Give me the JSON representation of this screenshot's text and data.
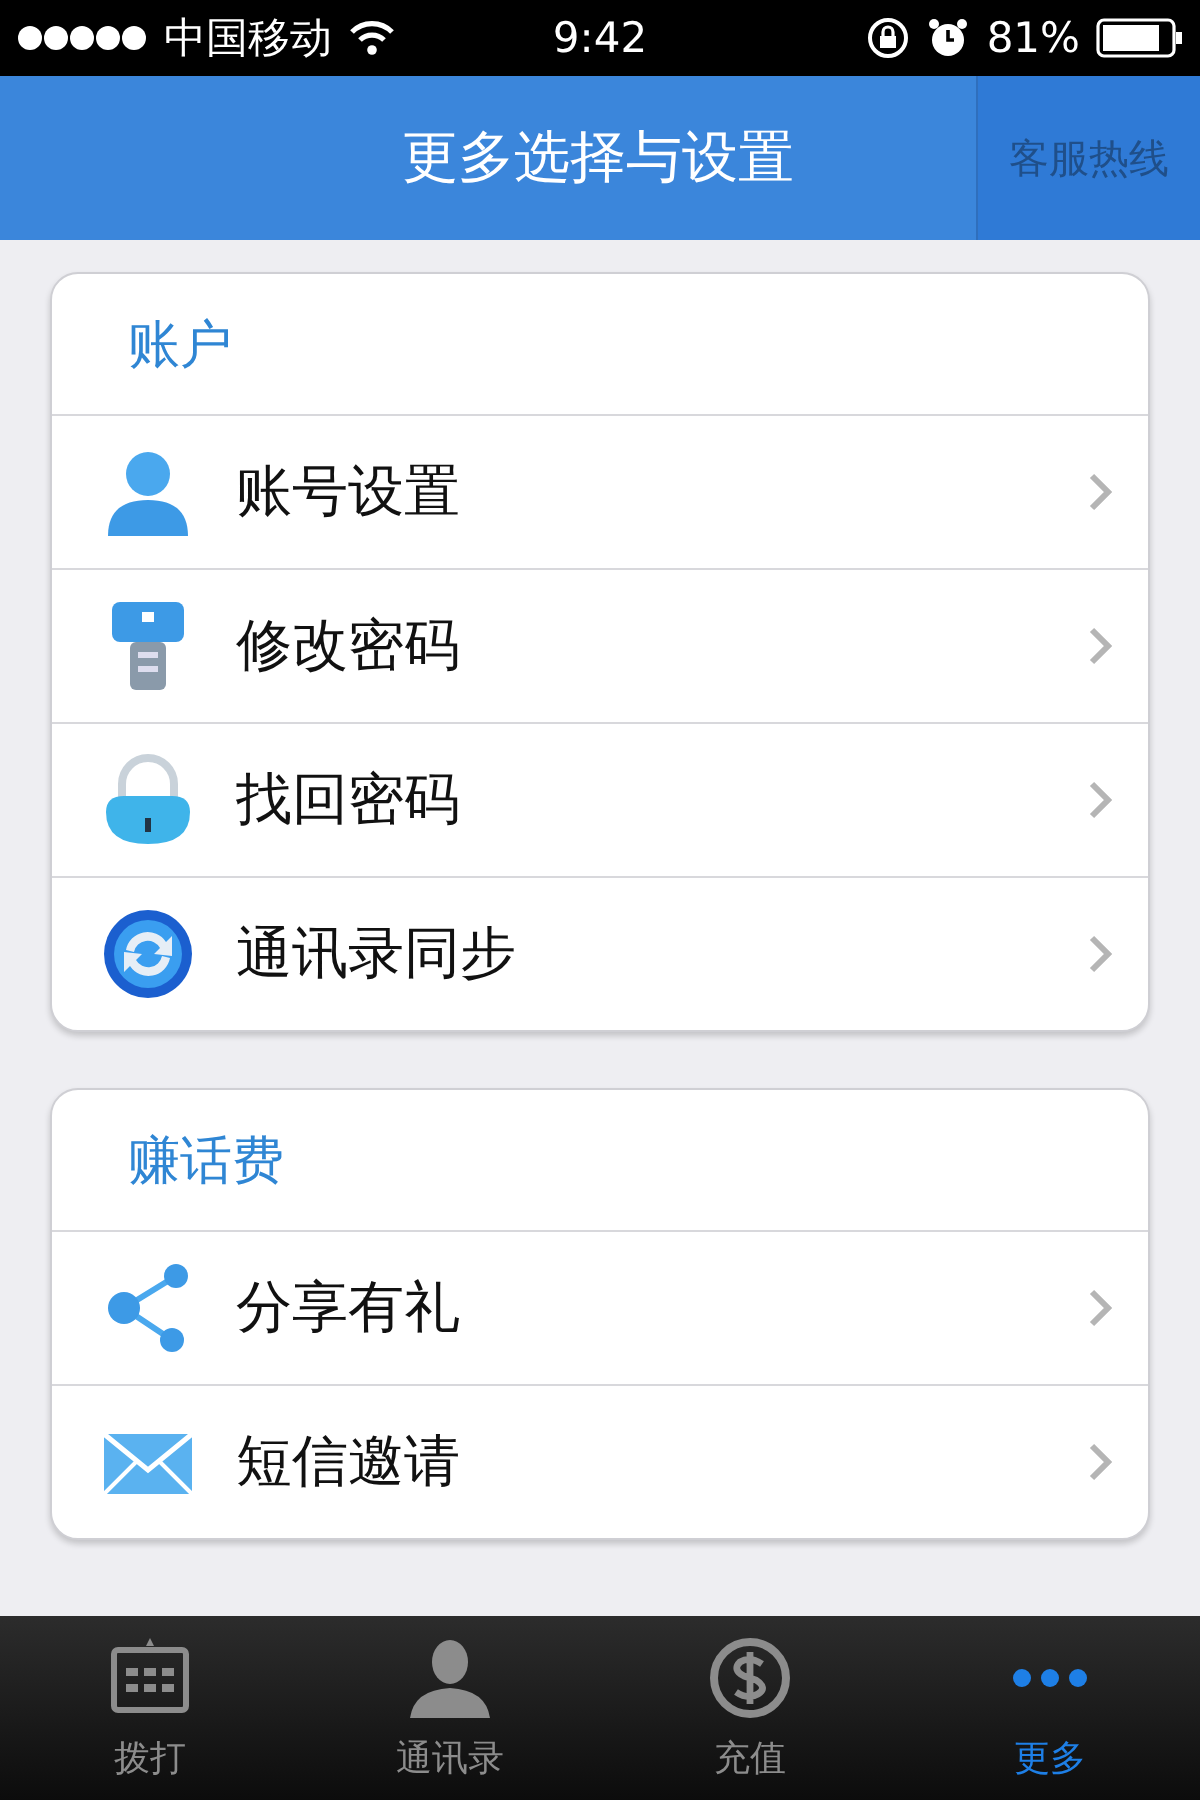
{
  "status_bar": {
    "carrier": "中国移动",
    "time": "9:42",
    "battery": "81%"
  },
  "header": {
    "title": "更多选择与设置",
    "action": "客服热线"
  },
  "sections": [
    {
      "title": "账户",
      "items": [
        {
          "label": "账号设置",
          "kind": "person"
        },
        {
          "label": "修改密码",
          "kind": "key"
        },
        {
          "label": "找回密码",
          "kind": "lock"
        },
        {
          "label": "通讯录同步",
          "kind": "sync"
        }
      ]
    },
    {
      "title": "赚话费",
      "items": [
        {
          "label": "分享有礼",
          "kind": "share"
        },
        {
          "label": "短信邀请",
          "kind": "mail"
        }
      ]
    }
  ],
  "tabs": [
    {
      "label": "拨打",
      "kind": "dial",
      "selected": false
    },
    {
      "label": "通讯录",
      "kind": "contact",
      "selected": false
    },
    {
      "label": "充值",
      "kind": "money",
      "selected": false
    },
    {
      "label": "更多",
      "kind": "more",
      "selected": true
    }
  ]
}
